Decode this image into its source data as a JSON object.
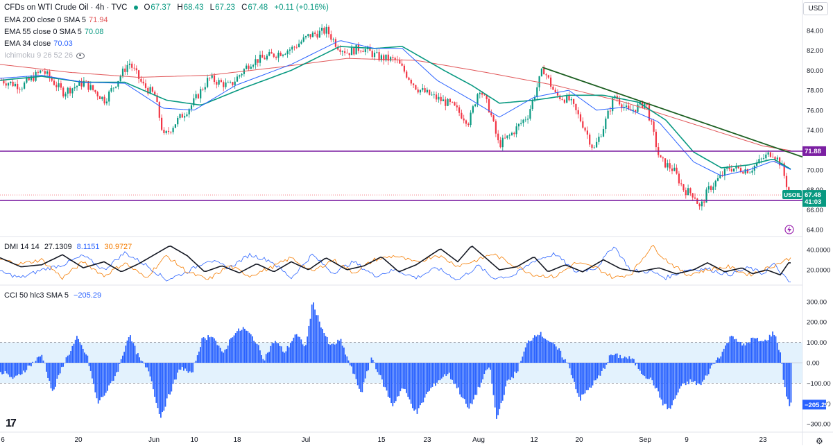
{
  "header": {
    "symbol_title": "CFDs on WTI Crude Oil · 4h · TVC",
    "ohlc": {
      "o": "67.37",
      "h": "68.43",
      "l": "67.23",
      "c": "67.48",
      "change": "+0.11 (+0.16%)"
    },
    "currency": "USD"
  },
  "indicators": [
    {
      "label": "EMA 200 close 0 SMA 5",
      "value": "71.94",
      "color": "#e15759"
    },
    {
      "label": "EMA 55 close 0 SMA 5",
      "value": "70.08",
      "color": "#089981"
    },
    {
      "label": "EMA 34 close",
      "value": "70.03",
      "color": "#2962ff"
    },
    {
      "label": "Ichimoku 9 26 52 26",
      "value": "",
      "color": "#b2b5be"
    }
  ],
  "dmi_legend": {
    "label": "DMI 14 14",
    "values": [
      "27.1309",
      "8.1151",
      "30.9727"
    ],
    "colors": [
      "#131722",
      "#2962ff",
      "#f57c00"
    ]
  },
  "cci_legend": {
    "label": "CCI 50 hlc3 SMA 5",
    "value": "−205.29"
  },
  "price_labels": {
    "resistance": "71.88",
    "current_symbol": "USOIL",
    "current_price": "67.48",
    "countdown": "41:03",
    "support": "66.93"
  },
  "colors": {
    "up": "#089981",
    "down": "#f23645",
    "trend": "#1b5e20",
    "hline": "#7b1fa2",
    "cci_fill": "#2962ff",
    "cci_band": "#e3f2fd"
  },
  "chart_data": {
    "type": "line",
    "title": "CFDs on WTI Crude Oil · 4h · TVC",
    "x_ticks": [
      "6",
      "20",
      "Jun",
      "10",
      "18",
      "Jul",
      "15",
      "23",
      "Aug",
      "12",
      "20",
      "Sep",
      "9",
      "23"
    ],
    "price_axis": {
      "ticks": [
        "84.00",
        "82.00",
        "80.00",
        "78.00",
        "76.00",
        "74.00",
        "72.00",
        "70.00",
        "68.00",
        "66.00",
        "64.00"
      ],
      "ylim": [
        63,
        85
      ]
    },
    "dmi_axis": {
      "ticks": [
        "40.0000",
        "20.0000"
      ]
    },
    "cci_axis": {
      "ticks": [
        "300.00",
        "200.00",
        "100.00",
        "0.00",
        "−100.00",
        "−200.00",
        "−300.00"
      ],
      "ylim": [
        -320,
        330
      ]
    },
    "price_anchors": {
      "x": [
        0,
        30,
        60,
        90,
        120,
        150,
        185,
        205,
        222,
        235,
        255,
        275,
        300,
        330,
        360,
        390,
        420,
        445,
        470,
        485,
        500,
        520,
        545,
        570,
        600,
        625,
        650,
        675,
        690,
        705,
        718,
        735,
        760,
        782,
        800,
        820,
        840,
        855,
        870,
        885,
        905,
        930,
        950,
        970,
        985,
        1000,
        1008,
        1020,
        1050,
        1080,
        1100,
        1112,
        1125,
        1137
      ],
      "y": [
        79.0,
        78.4,
        80.0,
        77.8,
        78.8,
        77.0,
        80.8,
        78.5,
        77.5,
        73.3,
        75.0,
        76.5,
        79.2,
        78.4,
        80.8,
        81.5,
        82.2,
        83.5,
        84.0,
        82.5,
        81.8,
        82.3,
        81.3,
        81.0,
        78.2,
        77.3,
        76.5,
        74.8,
        78.3,
        76.0,
        72.5,
        73.5,
        75.5,
        80.2,
        77.5,
        77.0,
        74.5,
        72.0,
        74.5,
        77.5,
        75.8,
        76.8,
        71.0,
        70.0,
        68.0,
        67.5,
        66.1,
        68.0,
        70.2,
        70.0,
        71.2,
        71.8,
        70.6,
        67.48
      ]
    },
    "series": [
      {
        "name": "EMA 200",
        "value": 71.94,
        "anchors_x": [
          0,
          100,
          200,
          300,
          400,
          500,
          600,
          700,
          800,
          900,
          1000,
          1100,
          1140
        ],
        "anchors_y": [
          80.6,
          79.8,
          79.3,
          79.5,
          80.3,
          81.2,
          81.0,
          79.8,
          78.5,
          76.8,
          74.6,
          72.4,
          71.94
        ]
      },
      {
        "name": "EMA 55",
        "value": 70.08,
        "anchors_x": [
          0,
          60,
          120,
          180,
          240,
          290,
          350,
          420,
          490,
          540,
          580,
          640,
          680,
          720,
          770,
          820,
          870,
          920,
          960,
          1000,
          1040,
          1080,
          1115,
          1140
        ],
        "anchors_y": [
          79.0,
          79.4,
          78.8,
          78.8,
          77.0,
          76.5,
          78.2,
          80.0,
          82.4,
          82.2,
          82.4,
          80.0,
          78.5,
          76.7,
          77.0,
          77.5,
          77.5,
          76.8,
          75.0,
          71.8,
          70.2,
          70.5,
          71.1,
          70.08
        ]
      },
      {
        "name": "EMA 34",
        "value": 70.03,
        "anchors_x": [
          0,
          60,
          120,
          180,
          235,
          280,
          340,
          420,
          490,
          540,
          580,
          630,
          680,
          720,
          770,
          820,
          860,
          900,
          950,
          1000,
          1040,
          1080,
          1115,
          1140
        ],
        "anchors_y": [
          79.2,
          79.5,
          78.8,
          78.7,
          76.2,
          76.0,
          78.5,
          80.6,
          83.0,
          82.2,
          82.2,
          79.0,
          77.0,
          75.3,
          77.3,
          78.0,
          76.0,
          76.3,
          74.8,
          70.8,
          69.4,
          70.0,
          70.9,
          70.03
        ]
      }
    ],
    "lines": {
      "trendline": {
        "from": [
          "Aug 12",
          80.3
        ],
        "to": [
          "Sep 23",
          71.3
        ]
      },
      "resistance": 71.88,
      "support": 66.93
    },
    "dmi": {
      "adx_anchors": [
        [
          0,
          32
        ],
        [
          30,
          23
        ],
        [
          60,
          25
        ],
        [
          90,
          35
        ],
        [
          120,
          22
        ],
        [
          150,
          28
        ],
        [
          175,
          18
        ],
        [
          200,
          26
        ],
        [
          245,
          44
        ],
        [
          270,
          34
        ],
        [
          295,
          18
        ],
        [
          320,
          24
        ],
        [
          345,
          17
        ],
        [
          370,
          26
        ],
        [
          395,
          18
        ],
        [
          420,
          28
        ],
        [
          445,
          20
        ],
        [
          470,
          32
        ],
        [
          500,
          20
        ],
        [
          525,
          24
        ],
        [
          550,
          33
        ],
        [
          575,
          18
        ],
        [
          600,
          25
        ],
        [
          635,
          41
        ],
        [
          660,
          28
        ],
        [
          680,
          44
        ],
        [
          700,
          32
        ],
        [
          720,
          20
        ],
        [
          745,
          23
        ],
        [
          770,
          33
        ],
        [
          790,
          18
        ],
        [
          815,
          25
        ],
        [
          840,
          18
        ],
        [
          870,
          30
        ],
        [
          895,
          21
        ],
        [
          920,
          18
        ],
        [
          950,
          22
        ],
        [
          975,
          16
        ],
        [
          1000,
          20
        ],
        [
          1020,
          27
        ],
        [
          1045,
          18
        ],
        [
          1070,
          22
        ],
        [
          1085,
          16
        ],
        [
          1105,
          20
        ],
        [
          1125,
          15
        ],
        [
          1137,
          27
        ]
      ],
      "plus_di_anchors": [
        [
          0,
          18
        ],
        [
          30,
          12
        ],
        [
          60,
          20
        ],
        [
          90,
          25
        ],
        [
          120,
          34
        ],
        [
          150,
          20
        ],
        [
          180,
          37
        ],
        [
          210,
          25
        ],
        [
          240,
          10
        ],
        [
          270,
          18
        ],
        [
          300,
          30
        ],
        [
          330,
          22
        ],
        [
          360,
          35
        ],
        [
          390,
          29
        ],
        [
          420,
          12
        ],
        [
          450,
          35
        ],
        [
          480,
          17
        ],
        [
          510,
          28
        ],
        [
          540,
          14
        ],
        [
          570,
          20
        ],
        [
          600,
          12
        ],
        [
          630,
          22
        ],
        [
          660,
          10
        ],
        [
          690,
          24
        ],
        [
          710,
          12
        ],
        [
          740,
          14
        ],
        [
          770,
          29
        ],
        [
          800,
          36
        ],
        [
          830,
          18
        ],
        [
          860,
          22
        ],
        [
          885,
          44
        ],
        [
          910,
          19
        ],
        [
          940,
          18
        ],
        [
          960,
          12
        ],
        [
          990,
          20
        ],
        [
          1020,
          21
        ],
        [
          1050,
          15
        ],
        [
          1080,
          22
        ],
        [
          1100,
          16
        ],
        [
          1115,
          26
        ],
        [
          1137,
          8
        ]
      ],
      "minus_di_anchors": [
        [
          0,
          30
        ],
        [
          30,
          26
        ],
        [
          60,
          30
        ],
        [
          90,
          12
        ],
        [
          120,
          28
        ],
        [
          150,
          14
        ],
        [
          180,
          27
        ],
        [
          210,
          12
        ],
        [
          240,
          34
        ],
        [
          270,
          18
        ],
        [
          300,
          10
        ],
        [
          330,
          24
        ],
        [
          360,
          14
        ],
        [
          390,
          22
        ],
        [
          420,
          32
        ],
        [
          450,
          18
        ],
        [
          480,
          30
        ],
        [
          510,
          17
        ],
        [
          540,
          30
        ],
        [
          570,
          34
        ],
        [
          600,
          27
        ],
        [
          630,
          35
        ],
        [
          660,
          24
        ],
        [
          690,
          30
        ],
        [
          710,
          36
        ],
        [
          740,
          25
        ],
        [
          770,
          15
        ],
        [
          800,
          13
        ],
        [
          830,
          27
        ],
        [
          860,
          22
        ],
        [
          885,
          12
        ],
        [
          910,
          16
        ],
        [
          940,
          44
        ],
        [
          960,
          30
        ],
        [
          990,
          15
        ],
        [
          1020,
          20
        ],
        [
          1050,
          23
        ],
        [
          1080,
          15
        ],
        [
          1100,
          20
        ],
        [
          1115,
          24
        ],
        [
          1137,
          31
        ]
      ]
    },
    "cci_anchors": [
      [
        0,
        -40
      ],
      [
        20,
        -80
      ],
      [
        40,
        -20
      ],
      [
        60,
        40
      ],
      [
        75,
        -150
      ],
      [
        90,
        -10
      ],
      [
        110,
        120
      ],
      [
        125,
        30
      ],
      [
        140,
        -200
      ],
      [
        155,
        -130
      ],
      [
        170,
        -30
      ],
      [
        185,
        140
      ],
      [
        200,
        20
      ],
      [
        215,
        -50
      ],
      [
        230,
        -270
      ],
      [
        245,
        -140
      ],
      [
        260,
        -20
      ],
      [
        275,
        -60
      ],
      [
        290,
        110
      ],
      [
        305,
        140
      ],
      [
        320,
        40
      ],
      [
        335,
        140
      ],
      [
        350,
        170
      ],
      [
        365,
        120
      ],
      [
        380,
        20
      ],
      [
        395,
        110
      ],
      [
        410,
        50
      ],
      [
        425,
        140
      ],
      [
        440,
        80
      ],
      [
        450,
        300
      ],
      [
        460,
        200
      ],
      [
        475,
        80
      ],
      [
        490,
        110
      ],
      [
        505,
        -20
      ],
      [
        520,
        -150
      ],
      [
        535,
        30
      ],
      [
        550,
        -90
      ],
      [
        565,
        -210
      ],
      [
        580,
        -120
      ],
      [
        600,
        -250
      ],
      [
        615,
        -150
      ],
      [
        630,
        -90
      ],
      [
        645,
        -50
      ],
      [
        660,
        -130
      ],
      [
        675,
        -230
      ],
      [
        690,
        -120
      ],
      [
        705,
        -10
      ],
      [
        715,
        -280
      ],
      [
        730,
        -100
      ],
      [
        745,
        -40
      ],
      [
        760,
        100
      ],
      [
        775,
        150
      ],
      [
        790,
        110
      ],
      [
        805,
        60
      ],
      [
        820,
        -20
      ],
      [
        835,
        -180
      ],
      [
        850,
        -120
      ],
      [
        865,
        -60
      ],
      [
        880,
        40
      ],
      [
        895,
        30
      ],
      [
        910,
        20
      ],
      [
        925,
        -50
      ],
      [
        940,
        -90
      ],
      [
        955,
        -200
      ],
      [
        965,
        -230
      ],
      [
        980,
        -120
      ],
      [
        995,
        -90
      ],
      [
        1010,
        -110
      ],
      [
        1025,
        -20
      ],
      [
        1040,
        50
      ],
      [
        1055,
        140
      ],
      [
        1070,
        80
      ],
      [
        1085,
        120
      ],
      [
        1100,
        100
      ],
      [
        1115,
        150
      ],
      [
        1125,
        40
      ],
      [
        1130,
        -120
      ],
      [
        1137,
        -205
      ]
    ],
    "cci_range": [
      -100,
      100
    ]
  }
}
